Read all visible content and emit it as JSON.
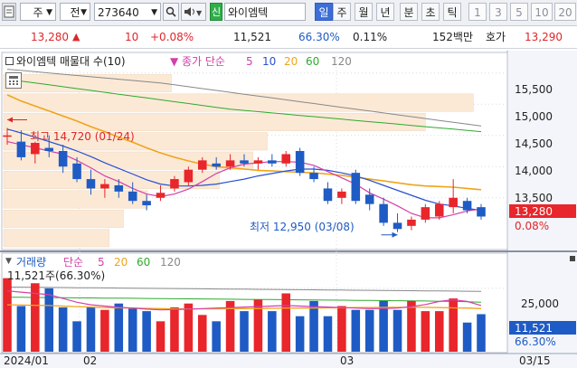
{
  "toolbar": {
    "market_label": "주",
    "prev_label": "전",
    "code": "273640",
    "new_badge": "신",
    "stock_name": "와이엠텍",
    "periods": [
      "일",
      "주",
      "월",
      "년",
      "분",
      "초",
      "틱"
    ],
    "active_period": "일",
    "minutes": [
      "1",
      "3",
      "5",
      "10",
      "20"
    ]
  },
  "quote": {
    "price": "13,280",
    "change": "10",
    "change_pct": "+0.08%",
    "volume": "11,521",
    "vol_ratio": "66.30%",
    "turnover": "0.11%",
    "amount": "152백만",
    "ask_label": "호가",
    "ask_price": "13,290"
  },
  "price_panel": {
    "legend_title": "와이엠텍 매물대 수(10)",
    "ma_label": "종가 단순",
    "ma_periods": [
      "5",
      "10",
      "20",
      "60",
      "120"
    ],
    "high_annotation": "최고 14,720 (01/24)",
    "low_annotation": "최저 12,950 (03/08)",
    "y_ticks": [
      "15,500",
      "15,000",
      "14,500",
      "14,000",
      "13,500"
    ],
    "current_price_tag": "13,280",
    "current_pct_tag": "0.08%"
  },
  "volume_panel": {
    "legend_title": "거래량",
    "ma_label": "단순",
    "ma_periods": [
      "5",
      "20",
      "60",
      "120"
    ],
    "current_volume_note": "11,521주(66.30%)",
    "y_ticks": [
      "25,000"
    ],
    "current_volume_tag": "11,521",
    "current_pct_tag": "66.30%"
  },
  "x_axis": {
    "labels": [
      "2024/01",
      "02",
      "03"
    ],
    "end_label": "03/15"
  },
  "colors": {
    "up": "#e8262b",
    "down": "#1f5bc4",
    "ma5": "#d43fa8",
    "ma10": "#2a4fd0",
    "ma20": "#f0a41a",
    "ma60": "#2eaa2e",
    "ma120": "#888888"
  },
  "chart_data": {
    "type": "candlestick",
    "candles": [
      {
        "o": 14480,
        "h": 14620,
        "l": 14350,
        "c": 14500
      },
      {
        "o": 14400,
        "h": 14580,
        "l": 14100,
        "c": 14150
      },
      {
        "o": 14200,
        "h": 14400,
        "l": 14050,
        "c": 14380
      },
      {
        "o": 14300,
        "h": 14500,
        "l": 14150,
        "c": 14250
      },
      {
        "o": 14250,
        "h": 14350,
        "l": 13900,
        "c": 14000
      },
      {
        "o": 14050,
        "h": 14150,
        "l": 13750,
        "c": 13800
      },
      {
        "o": 13800,
        "h": 13950,
        "l": 13550,
        "c": 13650
      },
      {
        "o": 13650,
        "h": 13800,
        "l": 13500,
        "c": 13720
      },
      {
        "o": 13700,
        "h": 13800,
        "l": 13500,
        "c": 13600
      },
      {
        "o": 13600,
        "h": 13750,
        "l": 13400,
        "c": 13450
      },
      {
        "o": 13450,
        "h": 13550,
        "l": 13300,
        "c": 13380
      },
      {
        "o": 13500,
        "h": 13700,
        "l": 13450,
        "c": 13580
      },
      {
        "o": 13650,
        "h": 13850,
        "l": 13600,
        "c": 13800
      },
      {
        "o": 13750,
        "h": 14000,
        "l": 13700,
        "c": 13950
      },
      {
        "o": 13950,
        "h": 14150,
        "l": 13900,
        "c": 14100
      },
      {
        "o": 14050,
        "h": 14150,
        "l": 13950,
        "c": 14000
      },
      {
        "o": 14000,
        "h": 14200,
        "l": 13950,
        "c": 14100
      },
      {
        "o": 14100,
        "h": 14200,
        "l": 14000,
        "c": 14050
      },
      {
        "o": 14050,
        "h": 14150,
        "l": 13950,
        "c": 14100
      },
      {
        "o": 14100,
        "h": 14200,
        "l": 14000,
        "c": 14050
      },
      {
        "o": 14050,
        "h": 14250,
        "l": 14000,
        "c": 14200
      },
      {
        "o": 14250,
        "h": 14300,
        "l": 13850,
        "c": 13900
      },
      {
        "o": 13900,
        "h": 14000,
        "l": 13750,
        "c": 13800
      },
      {
        "o": 13650,
        "h": 13750,
        "l": 13400,
        "c": 13450
      },
      {
        "o": 13500,
        "h": 13650,
        "l": 13400,
        "c": 13600
      },
      {
        "o": 13900,
        "h": 13950,
        "l": 13400,
        "c": 13450
      },
      {
        "o": 13550,
        "h": 13650,
        "l": 13300,
        "c": 13400
      },
      {
        "o": 13400,
        "h": 13500,
        "l": 13050,
        "c": 13100
      },
      {
        "o": 13100,
        "h": 13250,
        "l": 12950,
        "c": 13000
      },
      {
        "o": 13050,
        "h": 13200,
        "l": 12980,
        "c": 13150
      },
      {
        "o": 13150,
        "h": 13400,
        "l": 13100,
        "c": 13350
      },
      {
        "o": 13200,
        "h": 13450,
        "l": 13150,
        "c": 13400
      },
      {
        "o": 13350,
        "h": 13800,
        "l": 13250,
        "c": 13500
      },
      {
        "o": 13450,
        "h": 13500,
        "l": 13250,
        "c": 13300
      },
      {
        "o": 13350,
        "h": 13400,
        "l": 13150,
        "c": 13200
      }
    ],
    "volumes": [
      29000,
      18000,
      27000,
      25000,
      17500,
      12000,
      17500,
      16500,
      19000,
      17000,
      16000,
      12000,
      17500,
      19000,
      14500,
      12000,
      20000,
      16000,
      20500,
      16000,
      23000,
      14000,
      20000,
      14000,
      18000,
      16500,
      16500,
      20000,
      16500,
      20000,
      16000,
      16000,
      21000,
      11500,
      14800
    ],
    "ma5": [
      14400,
      14350,
      14300,
      14250,
      14200,
      14100,
      13980,
      13850,
      13760,
      13650,
      13560,
      13520,
      13560,
      13640,
      13760,
      13890,
      13980,
      14040,
      14060,
      14080,
      14080,
      14070,
      14020,
      13920,
      13820,
      13720,
      13580,
      13480,
      13370,
      13250,
      13180,
      13180,
      13230,
      13290,
      13320
    ],
    "ma10": [
      14600,
      14540,
      14470,
      14400,
      14330,
      14250,
      14160,
      14060,
      13970,
      13880,
      13790,
      13720,
      13690,
      13690,
      13700,
      13720,
      13760,
      13800,
      13850,
      13890,
      13930,
      13960,
      13960,
      13940,
      13900,
      13850,
      13780,
      13700,
      13620,
      13540,
      13460,
      13400,
      13370,
      13330,
      13300
    ],
    "ma20": [
      15150,
      15050,
      14970,
      14890,
      14810,
      14730,
      14640,
      14560,
      14470,
      14390,
      14300,
      14220,
      14150,
      14090,
      14040,
      14000,
      13980,
      13960,
      13940,
      13930,
      13920,
      13910,
      13900,
      13880,
      13860,
      13830,
      13800,
      13770,
      13740,
      13710,
      13690,
      13680,
      13670,
      13650,
      13630
    ],
    "ma60": [
      15400,
      15370,
      15340,
      15310,
      15280,
      15250,
      15220,
      15190,
      15160,
      15130,
      15100,
      15070,
      15040,
      15010,
      14980,
      14950,
      14920,
      14900,
      14880,
      14860,
      14840,
      14820,
      14800,
      14780,
      14760,
      14740,
      14720,
      14700,
      14680,
      14660,
      14640,
      14620,
      14600,
      14580,
      14560
    ],
    "ma120": [
      15560,
      15540,
      15520,
      15500,
      15480,
      15460,
      15440,
      15420,
      15400,
      15380,
      15360,
      15340,
      15310,
      15280,
      15250,
      15220,
      15190,
      15160,
      15130,
      15100,
      15070,
      15040,
      15010,
      14980,
      14950,
      14920,
      14890,
      14860,
      14830,
      14800,
      14770,
      14740,
      14710,
      14680,
      14650
    ],
    "vol_ma5": [
      24000,
      23500,
      23000,
      22500,
      21000,
      19500,
      18500,
      18000,
      17500,
      17200,
      16800,
      16500,
      16600,
      16800,
      17000,
      17200,
      17400,
      17600,
      17800,
      18000,
      18200,
      18000,
      17800,
      17600,
      17400,
      17200,
      17000,
      17000,
      17200,
      17800,
      18600,
      19800,
      20500,
      19800,
      18200
    ],
    "vol_ma20": [
      18500,
      18400,
      18300,
      18200,
      18000,
      17800,
      17600,
      17400,
      17300,
      17200,
      17100,
      17000,
      16900,
      16900,
      16900,
      16900,
      17000,
      17000,
      17000,
      17100,
      17200,
      17200,
      17200,
      17300,
      17300,
      17400,
      17400,
      17500,
      17500,
      17500,
      17500,
      17400,
      17300,
      17200,
      17000
    ],
    "vol_ma60": [
      21500,
      21450,
      21400,
      21350,
      21300,
      21250,
      21200,
      21150,
      21100,
      21050,
      21000,
      20950,
      20900,
      20850,
      20800,
      20750,
      20700,
      20650,
      20600,
      20550,
      20500,
      20450,
      20400,
      20350,
      20300,
      20250,
      20200,
      20150,
      20100,
      20050,
      20000,
      19900,
      19800,
      19700,
      19500
    ],
    "vol_ma120": [
      25500,
      25450,
      25400,
      25350,
      25300,
      25250,
      25200,
      25150,
      25100,
      25050,
      25000,
      24950,
      24900,
      24850,
      24800,
      24750,
      24700,
      24650,
      24600,
      24550,
      24500,
      24450,
      24400,
      24350,
      24300,
      24250,
      24200,
      24150,
      24100,
      24050,
      24000,
      23950,
      23900,
      23850,
      23800
    ],
    "volume_profile": [
      0.22,
      0.25,
      0.3,
      0.45,
      0.52,
      0.55,
      0.88,
      0.98,
      0.35,
      0.0
    ],
    "price_ylim": [
      12700,
      15800
    ],
    "volume_ylim": [
      0,
      36000
    ]
  }
}
